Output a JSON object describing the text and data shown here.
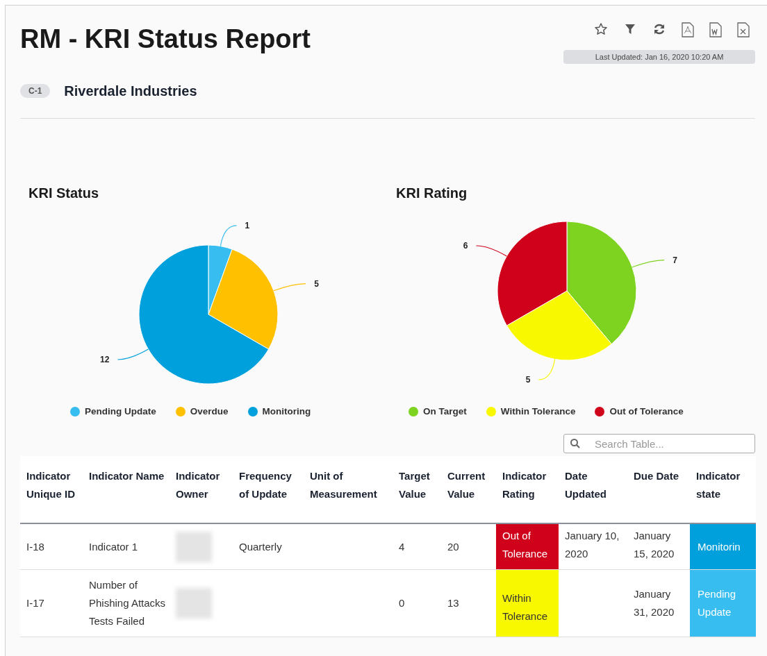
{
  "title": "RM - KRI Status Report",
  "toolbar": {
    "last_updated": "Last Updated: Jan 16, 2020 10:20 AM"
  },
  "entity": {
    "badge": "C-1",
    "name": "Riverdale Industries"
  },
  "charts": [
    {
      "chart_data": {
        "type": "pie",
        "categories": [
          "Pending Update",
          "Overdue",
          "Monitoring"
        ],
        "series": [
          {
            "name": "KRI Status",
            "values": [
              1,
              5,
              12
            ]
          }
        ],
        "colors": [
          "#38bdf0",
          "#ffc000",
          "#00a0dc"
        ],
        "data_labels": true
      }
    },
    {
      "chart_data": {
        "type": "pie",
        "categories": [
          "On Target",
          "Within Tolerance",
          "Out of Tolerance"
        ],
        "series": [
          {
            "name": "KRI Rating",
            "values": [
              7,
              5,
              6
            ]
          }
        ],
        "colors": [
          "#7ed321",
          "#f8f800",
          "#d0021b"
        ],
        "data_labels": true
      }
    }
  ],
  "search": {
    "placeholder": "Search Table..."
  },
  "table": {
    "columns": [
      "Indicator Unique ID",
      "Indicator Name",
      "Indicator Owner",
      "Frequency of Update",
      "Unit of Measurement",
      "Target Value",
      "Current Value",
      "Indicator Rating",
      "Date Updated",
      "Due Date",
      "Indicator state"
    ],
    "rows": [
      {
        "id": "I-18",
        "name": "Indicator 1",
        "frequency": "Quarterly",
        "target": "4",
        "current": "20",
        "rating": {
          "text": "Out of Tolerance",
          "color": "#d0021b"
        },
        "date_updated": "January 10, 2020",
        "due_date": "January 15, 2020",
        "state": {
          "text": "Monitorin",
          "color": "#00a0dc"
        }
      },
      {
        "id": "I-17",
        "name": "Number of Phishing Attacks Tests Failed",
        "target": "0",
        "current": "13",
        "rating": {
          "text": "Within Tolerance",
          "color": "#f8f800"
        },
        "due_date": "January 31, 2020",
        "state": {
          "text": "Pending Update",
          "color": "#38bdf0"
        }
      }
    ]
  }
}
